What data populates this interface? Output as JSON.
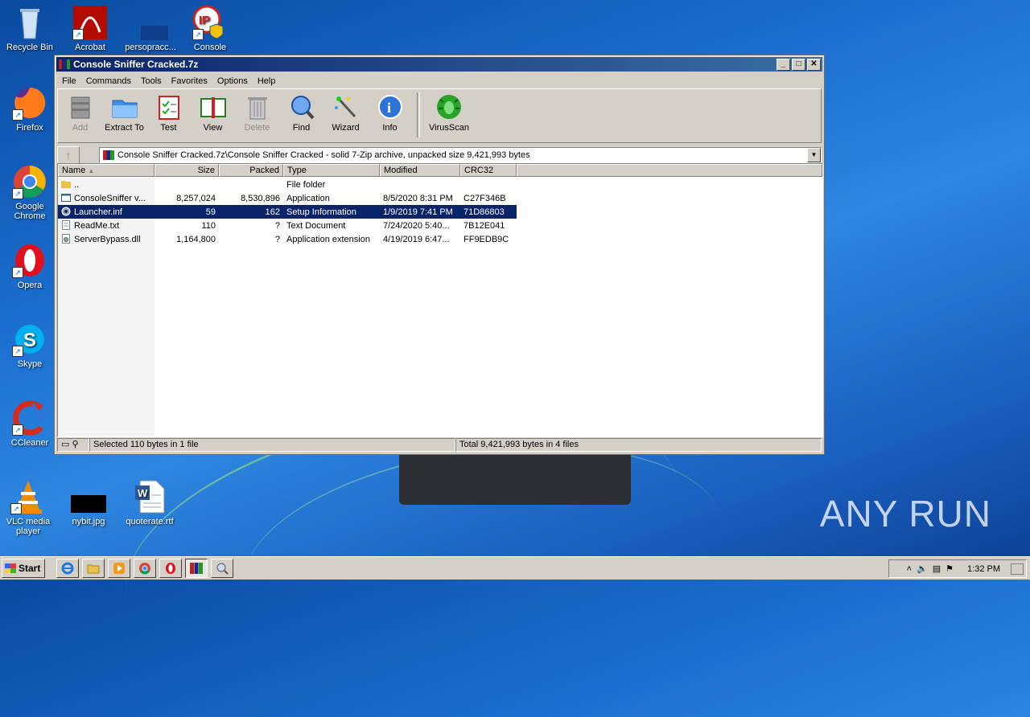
{
  "desktop": {
    "icons": [
      {
        "label": "Recycle Bin",
        "icon": "recycle-bin-icon"
      },
      {
        "label": "Acrobat",
        "icon": "acrobat-icon"
      },
      {
        "label": "persopracc...",
        "icon": "file-icon"
      },
      {
        "label": "Console",
        "icon": "ip-console-icon"
      },
      {
        "label": "Firefox",
        "icon": "firefox-icon"
      },
      {
        "label": "Google Chrome",
        "icon": "chrome-icon"
      },
      {
        "label": "Opera",
        "icon": "opera-icon"
      },
      {
        "label": "Skype",
        "icon": "skype-icon"
      },
      {
        "label": "CCleaner",
        "icon": "ccleaner-icon"
      },
      {
        "label": "VLC media player",
        "icon": "vlc-icon"
      },
      {
        "label": "nybit.jpg",
        "icon": "image-file-icon"
      },
      {
        "label": "quoterate.rtf",
        "icon": "word-document-icon"
      }
    ],
    "watermark": "ANY RUN"
  },
  "window": {
    "title": "Console Sniffer Cracked.7z",
    "menu": [
      "File",
      "Commands",
      "Tools",
      "Favorites",
      "Options",
      "Help"
    ],
    "toolbar": [
      {
        "label": "Add",
        "icon": "add-archive-icon",
        "disabled": true
      },
      {
        "label": "Extract To",
        "icon": "extract-folder-icon",
        "disabled": false
      },
      {
        "label": "Test",
        "icon": "test-clipboard-icon",
        "disabled": false
      },
      {
        "label": "View",
        "icon": "view-book-icon",
        "disabled": false
      },
      {
        "label": "Delete",
        "icon": "trash-icon",
        "disabled": true
      },
      {
        "label": "Find",
        "icon": "magnifier-icon",
        "disabled": false
      },
      {
        "label": "Wizard",
        "icon": "wizard-wand-icon",
        "disabled": false
      },
      {
        "label": "Info",
        "icon": "info-icon",
        "disabled": false
      },
      {
        "label": "VirusScan",
        "icon": "virus-scan-icon",
        "disabled": false
      }
    ],
    "address": "Console Sniffer Cracked.7z\\Console Sniffer Cracked - solid 7-Zip archive, unpacked size 9,421,993 bytes",
    "columns": [
      "Name",
      "Size",
      "Packed",
      "Type",
      "Modified",
      "CRC32"
    ],
    "files": [
      {
        "name": "..",
        "size": "",
        "packed": "",
        "type": "File folder",
        "modified": "",
        "crc": "",
        "icon": "folder-icon"
      },
      {
        "name": "ConsoleSniffer v...",
        "size": "8,257,024",
        "packed": "8,530,896",
        "type": "Application",
        "modified": "8/5/2020 8:31 PM",
        "crc": "C27F346B",
        "icon": "application-icon"
      },
      {
        "name": "Launcher.inf",
        "size": "59",
        "packed": "162",
        "type": "Setup Information",
        "modified": "1/9/2019 7:41 PM",
        "crc": "71D86803",
        "icon": "setup-gear-icon",
        "selected": true
      },
      {
        "name": "ReadMe.txt",
        "size": "110",
        "packed": "?",
        "type": "Text Document",
        "modified": "7/24/2020 5:40...",
        "crc": "7B12E041",
        "icon": "text-file-icon"
      },
      {
        "name": "ServerBypass.dll",
        "size": "1,164,800",
        "packed": "?",
        "type": "Application extension",
        "modified": "4/19/2019 6:47...",
        "crc": "FF9EDB9C",
        "icon": "dll-file-icon"
      }
    ],
    "status_left": "Selected 110 bytes in 1 file",
    "status_right": "Total 9,421,993 bytes in 4 files"
  },
  "taskbar": {
    "start_label": "Start",
    "clock": "1:32 PM",
    "buttons": [
      "internet-explorer-icon",
      "explorer-folder-icon",
      "media-player-icon",
      "chrome-icon",
      "opera-icon",
      "winrar-icon",
      "magnifier-app-icon"
    ]
  }
}
